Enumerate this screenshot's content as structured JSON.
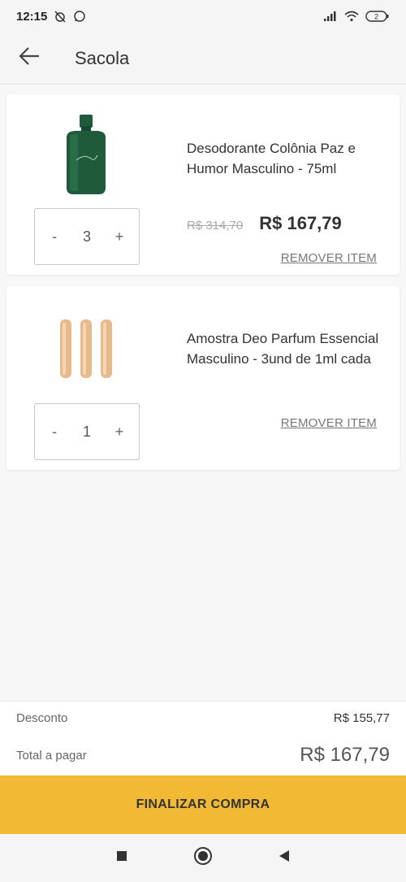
{
  "status_bar": {
    "time": "12:15",
    "battery": "2"
  },
  "header": {
    "title": "Sacola"
  },
  "cart": {
    "items": [
      {
        "name": "Desodorante Colônia Paz e Humor Masculino - 75ml",
        "quantity": "3",
        "old_price": "R$ 314,70",
        "price": "R$ 167,79",
        "remove_label": "REMOVER ITEM",
        "decrement_label": "-",
        "increment_label": "+"
      },
      {
        "name": "Amostra Deo Parfum Essencial Masculino - 3und de 1ml cada",
        "quantity": "1",
        "remove_label": "REMOVER ITEM",
        "decrement_label": "-",
        "increment_label": "+"
      }
    ]
  },
  "summary": {
    "discount_label": "Desconto",
    "discount_value": "R$ 155,77",
    "total_label": "Total a pagar",
    "total_value": "R$ 167,79"
  },
  "checkout": {
    "label": "FINALIZAR COMPRA"
  },
  "colors": {
    "checkout_bg": "#f2b935",
    "bottle_green": "#1f5a3a"
  }
}
